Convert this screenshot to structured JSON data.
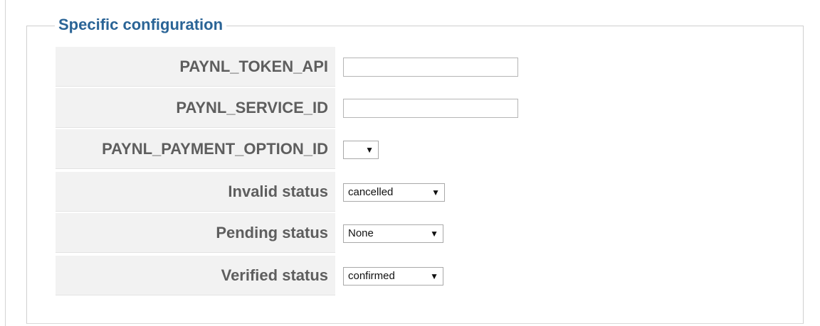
{
  "legend": "Specific configuration",
  "fields": [
    {
      "label": "PAYNL_TOKEN_API",
      "value": ""
    },
    {
      "label": "PAYNL_SERVICE_ID",
      "value": ""
    },
    {
      "label": "PAYNL_PAYMENT_OPTION_ID",
      "selected": ""
    },
    {
      "label": "Invalid status",
      "selected": "cancelled"
    },
    {
      "label": "Pending status",
      "selected": "None"
    },
    {
      "label": "Verified status",
      "selected": "confirmed"
    }
  ],
  "icons": {
    "dropdown": "▼"
  }
}
